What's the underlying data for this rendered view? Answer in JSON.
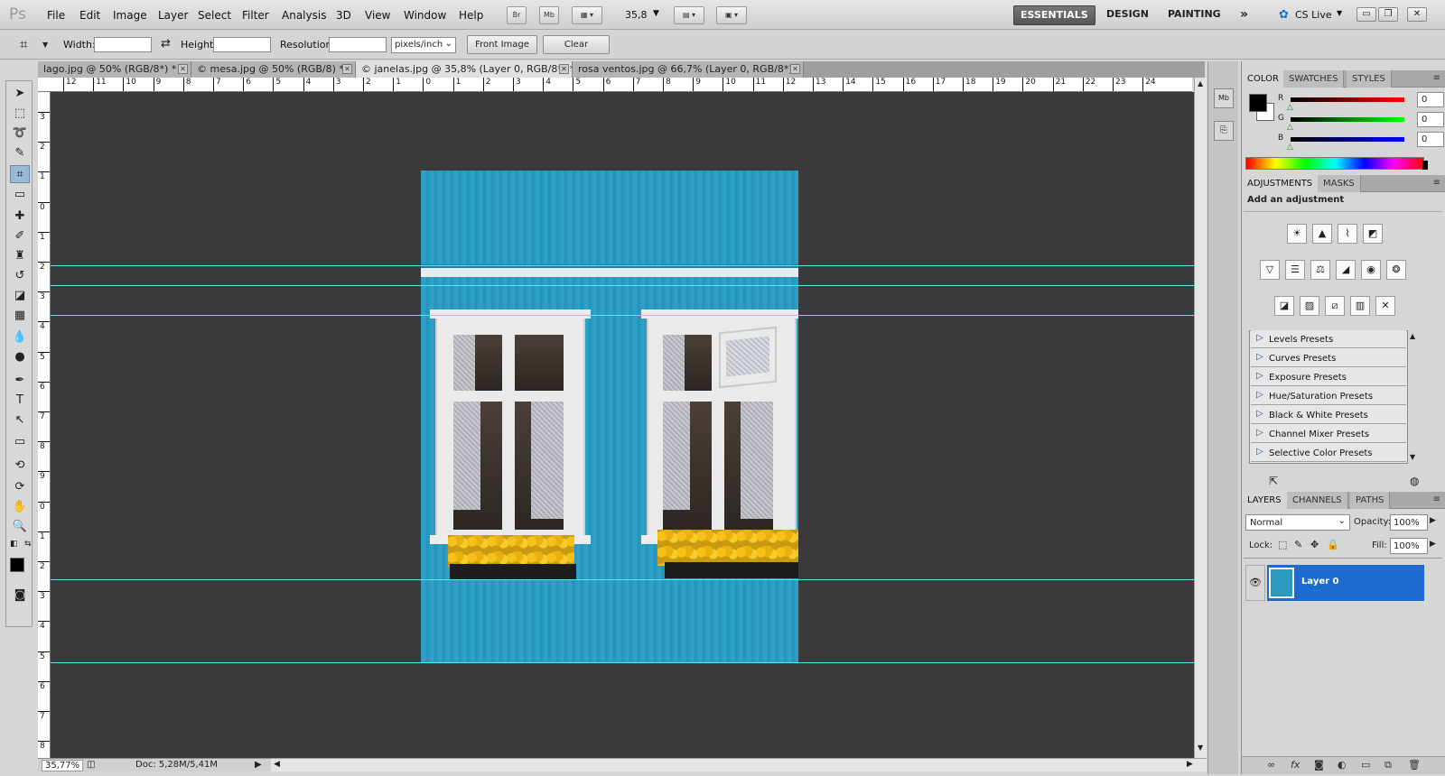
{
  "app": {
    "logo": "Ps"
  },
  "menu": [
    "File",
    "Edit",
    "Image",
    "Layer",
    "Select",
    "Filter",
    "Analysis",
    "3D",
    "View",
    "Window",
    "Help"
  ],
  "appbar": {
    "bridge": "Br",
    "minibridge": "Mb",
    "zoom": "35,8"
  },
  "workspaces": {
    "essentials": "ESSENTIALS",
    "design": "DESIGN",
    "painting": "PAINTING",
    "more": "»",
    "cslive": "CS Live"
  },
  "options": {
    "width_label": "Width:",
    "height_label": "Height:",
    "resolution_label": "Resolution:",
    "resolution_unit": "pixels/inch",
    "front_image": "Front Image",
    "clear": "Clear"
  },
  "tabs": [
    {
      "label": "lago.jpg @ 50% (RGB/8*) *"
    },
    {
      "label": "© mesa.jpg @ 50% (RGB/8) *"
    },
    {
      "label": "© janelas.jpg @ 35,8% (Layer 0, RGB/8*) *"
    },
    {
      "label": "rosa ventos.jpg @ 66,7% (Layer 0, RGB/8*) *"
    }
  ],
  "ruler_top": [
    "12",
    "11",
    "10",
    "9",
    "8",
    "7",
    "6",
    "5",
    "4",
    "3",
    "2",
    "1",
    "0",
    "1",
    "2",
    "3",
    "4",
    "5",
    "6",
    "7",
    "8",
    "9",
    "10",
    "11",
    "12",
    "13",
    "14",
    "15",
    "16",
    "17",
    "18",
    "19",
    "20",
    "21",
    "22",
    "23",
    "24"
  ],
  "ruler_left": [
    "3",
    "2",
    "1",
    "0",
    "1",
    "2",
    "3",
    "4",
    "5",
    "6",
    "7",
    "8",
    "9",
    "0",
    "1",
    "2",
    "3",
    "4",
    "5",
    "6",
    "7",
    "8"
  ],
  "status": {
    "zoom": "35,77%",
    "doc": "Doc: 5,28M/5,41M"
  },
  "color_panel": {
    "tabs": [
      "COLOR",
      "SWATCHES",
      "STYLES"
    ],
    "r_label": "R",
    "g_label": "G",
    "b_label": "B",
    "r": "0",
    "g": "0",
    "b": "0"
  },
  "adjustments": {
    "tabs": [
      "ADJUSTMENTS",
      "MASKS"
    ],
    "title": "Add an adjustment",
    "presets": [
      "Levels Presets",
      "Curves Presets",
      "Exposure Presets",
      "Hue/Saturation Presets",
      "Black & White Presets",
      "Channel Mixer Presets",
      "Selective Color Presets"
    ]
  },
  "layers": {
    "tabs": [
      "LAYERS",
      "CHANNELS",
      "PATHS"
    ],
    "blend": "Normal",
    "opacity_label": "Opacity:",
    "opacity": "100%",
    "lock_label": "Lock:",
    "fill_label": "Fill:",
    "fill": "100%",
    "layer_name": "Layer 0"
  },
  "colors": {
    "accent": "#1e6bcf",
    "canvas": "#3a3a3a",
    "guide": "#55e8f0",
    "wall": "#2a9ac0"
  }
}
